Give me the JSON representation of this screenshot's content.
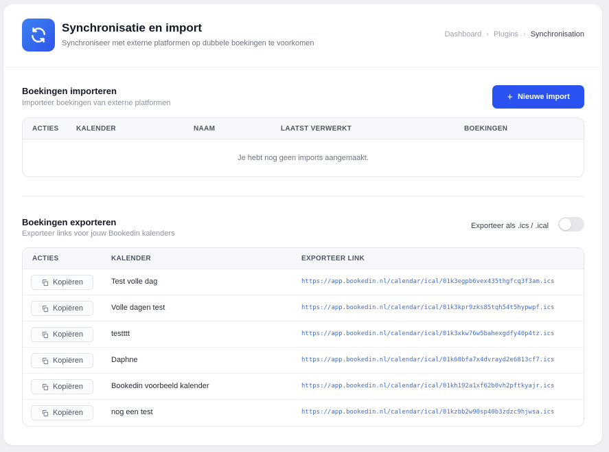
{
  "header": {
    "title": "Synchronisatie en import",
    "subtitle": "Synchroniseer met externe platformen op dubbele boekingen te voorkomen",
    "icon": "sync-icon",
    "accent_color": "#2f55e8"
  },
  "breadcrumb": {
    "items": [
      "Dashboard",
      "Plugins",
      "Synchronisation"
    ]
  },
  "import_section": {
    "title": "Boekingen importeren",
    "description": "Importeer boekingen van externe platformen",
    "new_button_label": "Nieuwe import",
    "columns": [
      "ACTIES",
      "KALENDER",
      "NAAM",
      "LAATST VERWERKT",
      "BOEKINGEN"
    ],
    "empty_message": "Je hebt nog geen imports aangemaakt."
  },
  "export_section": {
    "title": "Boekingen exporteren",
    "description": "Exporteer links voor jouw Bookedin kalenders",
    "toggle_label": "Exporteer als .ics / .ical",
    "toggle_on": false,
    "columns": [
      "ACTIES",
      "KALENDER",
      "EXPORTEER LINK"
    ],
    "copy_label": "Kopiëren",
    "rows": [
      {
        "calendar": "Test volle dag",
        "link": "https://app.bookedin.nl/calendar/ical/01k3egpb6vex435thgfcq3f3am.ics"
      },
      {
        "calendar": "Volle dagen test",
        "link": "https://app.bookedin.nl/calendar/ical/01k3kpr9zks85tqh54t5hypwpf.ics"
      },
      {
        "calendar": "testttt",
        "link": "https://app.bookedin.nl/calendar/ical/01k3xkw76w5bahexgdfy40p4tz.ics"
      },
      {
        "calendar": "Daphne",
        "link": "https://app.bookedin.nl/calendar/ical/01k68bfa7x4dvrayd2e6813cf7.ics"
      },
      {
        "calendar": "Bookedin voorbeeld kalender",
        "link": "https://app.bookedin.nl/calendar/ical/01kh192a1xf62b0vh2pftkyajr.ics"
      },
      {
        "calendar": "nog een test",
        "link": "https://app.bookedin.nl/calendar/ical/01kzbb2w90sp40b3zdzc9hjwsa.ics"
      }
    ]
  }
}
